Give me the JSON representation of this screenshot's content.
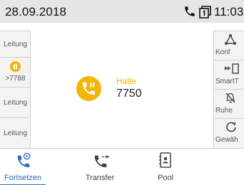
{
  "status_bar": {
    "date": "28.09.2018",
    "time": "11:03",
    "icons": [
      "phone-icon",
      "call-list-icon"
    ]
  },
  "line_keys": [
    {
      "label": "Leitung"
    },
    {
      "label": ">7788",
      "icon": "hold-icon",
      "state_color": "#f2b705"
    },
    {
      "label": "Leitung"
    },
    {
      "label": "Leitung"
    }
  ],
  "call": {
    "status": "Halte",
    "number": "7750",
    "icon": "call-on-hold-icon",
    "status_color": "#f2b705"
  },
  "soft_keys": [
    {
      "label": "Konf",
      "icon": "conference-icon"
    },
    {
      "label": "SmartT",
      "icon": "smart-transfer-icon"
    },
    {
      "label": "Ruhe",
      "icon": "do-not-disturb-icon"
    },
    {
      "label": "Gewäh",
      "icon": "redial-icon"
    }
  ],
  "tabs": [
    {
      "label": "Fortsetzen",
      "icon": "resume-call-icon",
      "active": true
    },
    {
      "label": "Transfer",
      "icon": "transfer-icon",
      "active": false
    },
    {
      "label": "Pool",
      "icon": "pool-icon",
      "active": false
    }
  ],
  "colors": {
    "accent": "#2d6db5",
    "hold": "#f2b705",
    "status_bar_bg": "#e6e6e6",
    "key_bg": "#f3f3f3"
  }
}
